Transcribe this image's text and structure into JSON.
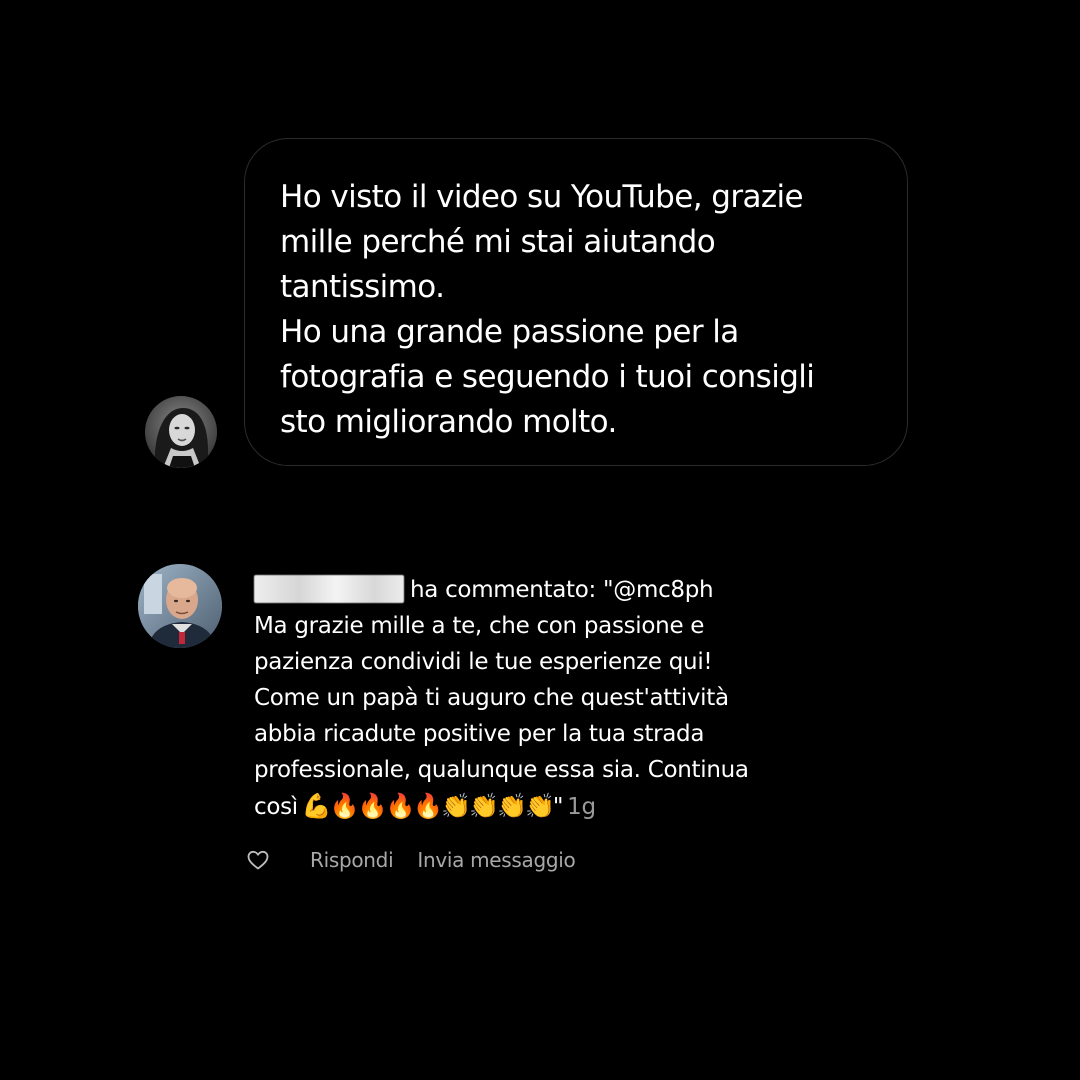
{
  "message": {
    "lines": [
      "Ho visto il video su YouTube, grazie",
      "mille perché mi stai aiutando",
      "tantissimo.",
      "Ho una grande passione per la",
      "fotografia e seguendo i tuoi consigli",
      "sto migliorando molto."
    ]
  },
  "comment": {
    "action_text": "ha commentato: \"@mc8ph",
    "lines": [
      "Ma grazie mille a te, che con passione e",
      "pazienza condividi le tue esperienze qui!",
      "Come un papà ti auguro che quest'attività",
      "abbia ricadute positive per la tua strada",
      "professionale, qualunque essa sia. Continua"
    ],
    "last_line_text": "così",
    "emojis": "💪🔥🔥🔥🔥👏👏👏👏",
    "closing_quote": "\"",
    "age": "1g"
  },
  "actions": {
    "like_icon": "heart-outline-icon",
    "reply_label": "Rispondi",
    "send_message_label": "Invia messaggio"
  },
  "colors": {
    "background": "#000000",
    "text": "#ffffff",
    "secondary_text": "#a8a8a8",
    "bubble_border": "#2b2b2b"
  }
}
